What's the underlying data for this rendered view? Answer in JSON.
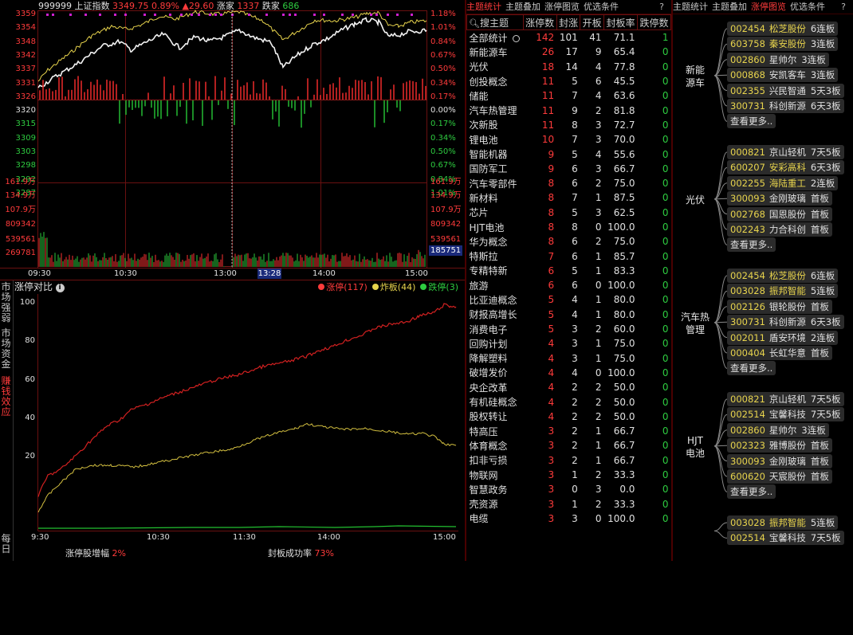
{
  "index_header": {
    "code": "999999",
    "name": "上证指数",
    "price": "3349.75",
    "pct": "0.89%",
    "change": "▲29.60",
    "up_label": "涨家",
    "up_count": "1337",
    "down_label": "跌家",
    "down_count": "686"
  },
  "price_axis_left": [
    "3359",
    "3354",
    "3348",
    "3342",
    "3337",
    "3331",
    "3326",
    "3320",
    "3315",
    "3309",
    "3303",
    "3298",
    "3292",
    "3287"
  ],
  "price_axis_right": [
    "1.18%",
    "1.01%",
    "0.84%",
    "0.67%",
    "0.50%",
    "0.34%",
    "0.17%",
    "0.00%",
    "0.17%",
    "0.34%",
    "0.50%",
    "0.67%",
    "0.84%",
    "1.01%"
  ],
  "vol_axis_left": [
    "161.9万",
    "134.9万",
    "107.9万",
    "809342",
    "539561",
    "269781"
  ],
  "vol_axis_right": [
    "161.9万",
    "134.9万",
    "107.9万",
    "809342",
    "539561"
  ],
  "vol_cursor_value": "185751",
  "time_axis": [
    "09:30",
    "10:30",
    "13:00",
    "14:00",
    "15:00"
  ],
  "cursor_time": "13:28",
  "bottom_panel": {
    "title": "涨停对比",
    "info_icon": "info-icon",
    "legend": [
      {
        "label": "涨停(117)",
        "color": "#ff3b3b"
      },
      {
        "label": "炸板(44)",
        "color": "#e8d44d"
      },
      {
        "label": "跌停(3)",
        "color": "#2ecc40"
      }
    ],
    "y_ticks": [
      "100",
      "80",
      "60",
      "40",
      "20"
    ],
    "x_ticks": [
      "9:30",
      "10:30",
      "11:30",
      "14:00",
      "15:00"
    ],
    "footer_left_label": "涨停股增幅",
    "footer_left_value": "2%",
    "footer_right_label": "封板成功率",
    "footer_right_value": "73%"
  },
  "side_tabs": [
    "市场强弱",
    "市场资金",
    "赚钱效应",
    "每日"
  ],
  "mid_tabs": {
    "items": [
      "主题统计",
      "主题叠加",
      "涨停图览",
      "优选条件"
    ],
    "help": "?"
  },
  "theme_table": {
    "headers": [
      "搜主题",
      "涨停数",
      "封涨",
      "开板",
      "封板率",
      "跌停数"
    ],
    "rows": [
      [
        "全部统计",
        "142",
        "101",
        "41",
        "71.1",
        "1"
      ],
      [
        "新能源车",
        "26",
        "17",
        "9",
        "65.4",
        "0"
      ],
      [
        "光伏",
        "18",
        "14",
        "4",
        "77.8",
        "0"
      ],
      [
        "创投概念",
        "11",
        "5",
        "6",
        "45.5",
        "0"
      ],
      [
        "储能",
        "11",
        "7",
        "4",
        "63.6",
        "0"
      ],
      [
        "汽车热管理",
        "11",
        "9",
        "2",
        "81.8",
        "0"
      ],
      [
        "次新股",
        "11",
        "8",
        "3",
        "72.7",
        "0"
      ],
      [
        "锂电池",
        "10",
        "7",
        "3",
        "70.0",
        "0"
      ],
      [
        "智能机器",
        "9",
        "5",
        "4",
        "55.6",
        "0"
      ],
      [
        "国防军工",
        "9",
        "6",
        "3",
        "66.7",
        "0"
      ],
      [
        "汽车零部件",
        "8",
        "6",
        "2",
        "75.0",
        "0"
      ],
      [
        "新材料",
        "8",
        "7",
        "1",
        "87.5",
        "0"
      ],
      [
        "芯片",
        "8",
        "5",
        "3",
        "62.5",
        "0"
      ],
      [
        "HJT电池",
        "8",
        "8",
        "0",
        "100.0",
        "0"
      ],
      [
        "华为概念",
        "8",
        "6",
        "2",
        "75.0",
        "0"
      ],
      [
        "特斯拉",
        "7",
        "6",
        "1",
        "85.7",
        "0"
      ],
      [
        "专精特新",
        "6",
        "5",
        "1",
        "83.3",
        "0"
      ],
      [
        "旅游",
        "6",
        "6",
        "0",
        "100.0",
        "0"
      ],
      [
        "比亚迪概念",
        "5",
        "4",
        "1",
        "80.0",
        "0"
      ],
      [
        "财报高增长",
        "5",
        "4",
        "1",
        "80.0",
        "0"
      ],
      [
        "消费电子",
        "5",
        "3",
        "2",
        "60.0",
        "0"
      ],
      [
        "回购计划",
        "4",
        "3",
        "1",
        "75.0",
        "0"
      ],
      [
        "降解塑料",
        "4",
        "3",
        "1",
        "75.0",
        "0"
      ],
      [
        "破增发价",
        "4",
        "4",
        "0",
        "100.0",
        "0"
      ],
      [
        "央企改革",
        "4",
        "2",
        "2",
        "50.0",
        "0"
      ],
      [
        "有机硅概念",
        "4",
        "2",
        "2",
        "50.0",
        "0"
      ],
      [
        "股权转让",
        "4",
        "2",
        "2",
        "50.0",
        "0"
      ],
      [
        "特高压",
        "3",
        "2",
        "1",
        "66.7",
        "0"
      ],
      [
        "体育概念",
        "3",
        "2",
        "1",
        "66.7",
        "0"
      ],
      [
        "扣非亏损",
        "3",
        "2",
        "1",
        "66.7",
        "0"
      ],
      [
        "物联网",
        "3",
        "1",
        "2",
        "33.3",
        "0"
      ],
      [
        "智慧政务",
        "3",
        "0",
        "3",
        "0.0",
        "0"
      ],
      [
        "壳资源",
        "3",
        "1",
        "2",
        "33.3",
        "0"
      ],
      [
        "电缆",
        "3",
        "3",
        "0",
        "100.0",
        "0"
      ]
    ]
  },
  "right_tabs": {
    "items": [
      "主题统计",
      "主题叠加",
      "涨停图览",
      "优选条件"
    ],
    "active": "涨停图览",
    "help": "?"
  },
  "limit_groups": [
    {
      "label": "新能\n源车",
      "stocks": [
        {
          "code": "002454",
          "name": "松芝股份",
          "board": "6连板",
          "hl": true
        },
        {
          "code": "603758",
          "name": "秦安股份",
          "board": "3连板",
          "hl": true
        },
        {
          "code": "002860",
          "name": "星帅尔",
          "board": "3连板",
          "hl": false
        },
        {
          "code": "000868",
          "name": "安凯客车",
          "board": "3连板",
          "hl": false
        },
        {
          "code": "002355",
          "name": "兴民智通",
          "board": "5天3板",
          "hl": false
        },
        {
          "code": "300731",
          "name": "科创新源",
          "board": "6天3板",
          "hl": false
        }
      ]
    },
    {
      "label": "光伏",
      "stocks": [
        {
          "code": "000821",
          "name": "京山轻机",
          "board": "7天5板",
          "hl": false
        },
        {
          "code": "600207",
          "name": "安彩高科",
          "board": "6天3板",
          "hl": true
        },
        {
          "code": "002255",
          "name": "海陆重工",
          "board": "2连板",
          "hl": true
        },
        {
          "code": "300093",
          "name": "金刚玻璃",
          "board": "首板",
          "hl": false
        },
        {
          "code": "002768",
          "name": "国恩股份",
          "board": "首板",
          "hl": false
        },
        {
          "code": "002243",
          "name": "力合科创",
          "board": "首板",
          "hl": false
        }
      ]
    },
    {
      "label": "汽车热\n管理",
      "stocks": [
        {
          "code": "002454",
          "name": "松芝股份",
          "board": "6连板",
          "hl": true
        },
        {
          "code": "003028",
          "name": "振邦智能",
          "board": "5连板",
          "hl": true
        },
        {
          "code": "002126",
          "name": "银轮股份",
          "board": "首板",
          "hl": false
        },
        {
          "code": "300731",
          "name": "科创新源",
          "board": "6天3板",
          "hl": false
        },
        {
          "code": "002011",
          "name": "盾安环境",
          "board": "2连板",
          "hl": false
        },
        {
          "code": "000404",
          "name": "长虹华意",
          "board": "首板",
          "hl": false
        }
      ]
    },
    {
      "label": "HJT\n电池",
      "stocks": [
        {
          "code": "000821",
          "name": "京山轻机",
          "board": "7天5板",
          "hl": false
        },
        {
          "code": "002514",
          "name": "宝馨科技",
          "board": "7天5板",
          "hl": false
        },
        {
          "code": "002860",
          "name": "星帅尔",
          "board": "3连板",
          "hl": false
        },
        {
          "code": "002323",
          "name": "雅博股份",
          "board": "首板",
          "hl": false
        },
        {
          "code": "300093",
          "name": "金刚玻璃",
          "board": "首板",
          "hl": false
        },
        {
          "code": "600620",
          "name": "天宸股份",
          "board": "首板",
          "hl": false
        }
      ]
    },
    {
      "label": "",
      "stocks": [
        {
          "code": "003028",
          "name": "振邦智能",
          "board": "5连板",
          "hl": true
        },
        {
          "code": "002514",
          "name": "宝馨科技",
          "board": "7天5板",
          "hl": false
        }
      ]
    }
  ],
  "more_label": "查看更多..",
  "colors": {
    "up": "#ff3b3b",
    "down": "#2ecc40",
    "yellow": "#e8d44d",
    "grid": "#6a1010"
  }
}
